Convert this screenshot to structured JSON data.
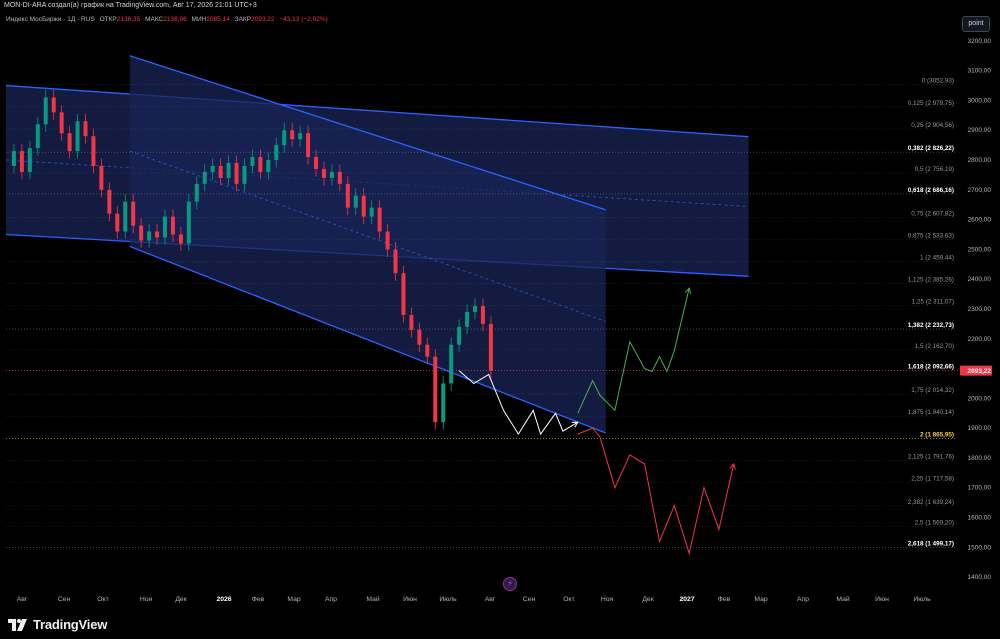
{
  "header": {
    "publish_line": "MON-DI-ARA создал(а) график на TradingView.com, Авг 17, 2026 21:01 UTC+3"
  },
  "legend": {
    "symbol": "Индекс МосБиржи · 1Д · RUS",
    "open_label": "ОТКР",
    "open": "2136,35",
    "high_label": "МАКС",
    "high": "2138,96",
    "low_label": "МИН",
    "low": "2085,14",
    "close_label": "ЗАКР",
    "close": "2093,22",
    "change": "−43,13 (−2,02%)"
  },
  "toolbar": {
    "point_label": "point"
  },
  "branding": {
    "logo_text": "TradingView"
  },
  "colors": {
    "background": "#000000",
    "channel_fill": "#1a2456",
    "channel_line": "#2962ff",
    "candle_up": "#089981",
    "candle_down": "#f23645",
    "projection_up": "#4caf50",
    "projection_down": "#f23645",
    "projection_neutral": "#ffffff",
    "price_tag": "#f23645"
  },
  "chart_data": {
    "type": "candlestick",
    "title": "",
    "x_ticks": [
      "Авг",
      "Сен",
      "Окт",
      "Ноя",
      "Дек",
      "2026",
      "Фев",
      "Мар",
      "Апр",
      "Май",
      "Июн",
      "Июль",
      "Авг",
      "Сен",
      "Окт",
      "Ноя",
      "Дек",
      "2027",
      "Фев",
      "Мар",
      "Апр",
      "Май",
      "Июн",
      "Июль"
    ],
    "y_ticks": [
      1400,
      1500,
      1600,
      1700,
      1800,
      1900,
      2000,
      2100,
      2200,
      2300,
      2400,
      2500,
      2600,
      2700,
      2800,
      2900,
      3000,
      3100,
      3200
    ],
    "y_tick_labels": [
      "1400,00",
      "1500,00",
      "1600,00",
      "1700,00",
      "1800,00",
      "1900,00",
      "2000,00",
      "2100,00",
      "2200,00",
      "2300,00",
      "2400,00",
      "2500,00",
      "2600,00",
      "2700,00",
      "2800,00",
      "2900,00",
      "3000,00",
      "3100,00",
      "3200,00"
    ],
    "ylim": [
      1350,
      3270
    ],
    "last_price": 2093.22,
    "last_price_label": "2093,22",
    "price_path": [
      {
        "x": 0,
        "y": 2780
      },
      {
        "x": 1,
        "y": 2830
      },
      {
        "x": 2,
        "y": 2760
      },
      {
        "x": 3,
        "y": 2840
      },
      {
        "x": 4,
        "y": 2920
      },
      {
        "x": 5,
        "y": 3010
      },
      {
        "x": 6,
        "y": 2960
      },
      {
        "x": 7,
        "y": 2890
      },
      {
        "x": 8,
        "y": 2830
      },
      {
        "x": 9,
        "y": 2930
      },
      {
        "x": 10,
        "y": 2880
      },
      {
        "x": 11,
        "y": 2780
      },
      {
        "x": 12,
        "y": 2700
      },
      {
        "x": 13,
        "y": 2620
      },
      {
        "x": 14,
        "y": 2560
      },
      {
        "x": 15,
        "y": 2660
      },
      {
        "x": 16,
        "y": 2580
      },
      {
        "x": 17,
        "y": 2530
      },
      {
        "x": 18,
        "y": 2560
      },
      {
        "x": 19,
        "y": 2540
      },
      {
        "x": 20,
        "y": 2610
      },
      {
        "x": 21,
        "y": 2550
      },
      {
        "x": 22,
        "y": 2520
      },
      {
        "x": 23,
        "y": 2660
      },
      {
        "x": 24,
        "y": 2720
      },
      {
        "x": 25,
        "y": 2760
      },
      {
        "x": 26,
        "y": 2780
      },
      {
        "x": 27,
        "y": 2740
      },
      {
        "x": 28,
        "y": 2790
      },
      {
        "x": 29,
        "y": 2720
      },
      {
        "x": 30,
        "y": 2780
      },
      {
        "x": 31,
        "y": 2810
      },
      {
        "x": 32,
        "y": 2760
      },
      {
        "x": 33,
        "y": 2800
      },
      {
        "x": 34,
        "y": 2850
      },
      {
        "x": 35,
        "y": 2900
      },
      {
        "x": 36,
        "y": 2870
      },
      {
        "x": 37,
        "y": 2890
      },
      {
        "x": 38,
        "y": 2810
      },
      {
        "x": 39,
        "y": 2770
      },
      {
        "x": 40,
        "y": 2740
      },
      {
        "x": 41,
        "y": 2760
      },
      {
        "x": 42,
        "y": 2720
      },
      {
        "x": 43,
        "y": 2640
      },
      {
        "x": 44,
        "y": 2680
      },
      {
        "x": 45,
        "y": 2610
      },
      {
        "x": 46,
        "y": 2640
      },
      {
        "x": 47,
        "y": 2560
      },
      {
        "x": 48,
        "y": 2500
      },
      {
        "x": 49,
        "y": 2420
      },
      {
        "x": 50,
        "y": 2280
      },
      {
        "x": 51,
        "y": 2230
      },
      {
        "x": 52,
        "y": 2180
      },
      {
        "x": 53,
        "y": 2140
      },
      {
        "x": 54,
        "y": 1920
      },
      {
        "x": 55,
        "y": 2050
      },
      {
        "x": 56,
        "y": 2180
      },
      {
        "x": 57,
        "y": 2240
      },
      {
        "x": 58,
        "y": 2290
      },
      {
        "x": 59,
        "y": 2310
      },
      {
        "x": 60,
        "y": 2250
      },
      {
        "x": 61,
        "y": 2093
      }
    ],
    "channels": [
      {
        "name": "",
        "type": "wide-descending",
        "upper": [
          {
            "x": 0,
            "y": 3050
          },
          {
            "x": 100,
            "y": 2830
          }
        ],
        "lower": [
          {
            "x": 0,
            "y": 2550
          },
          {
            "x": 100,
            "y": 2370
          }
        ]
      },
      {
        "name": "",
        "type": "steep-descending",
        "upper": [
          {
            "x": 13,
            "y": 3150
          },
          {
            "x": 100,
            "y": 2250
          }
        ],
        "lower": [
          {
            "x": 13,
            "y": 2510
          },
          {
            "x": 100,
            "y": 1420
          }
        ]
      }
    ],
    "fibonacci_levels": [
      {
        "ratio": "0",
        "value": 3052.93,
        "label": "0 (3052,93)"
      },
      {
        "ratio": "0,125",
        "value": 2978.75,
        "label": "0,125 (2 978,75)"
      },
      {
        "ratio": "0,25",
        "value": 2904.56,
        "label": "0,25 (2 904,56)"
      },
      {
        "ratio": "0,382",
        "value": 2826.22,
        "label": "0,382 (2 826,22)",
        "highlight": true
      },
      {
        "ratio": "0,5",
        "value": 2756.19,
        "label": "0,5 (2 756,19)"
      },
      {
        "ratio": "0,618",
        "value": 2686.16,
        "label": "0,618 (2 686,16)",
        "highlight": true
      },
      {
        "ratio": "0,75",
        "value": 2607.82,
        "label": "0,75 (2 607,82)"
      },
      {
        "ratio": "0,875",
        "value": 2533.63,
        "label": "0,875 (2 533,63)"
      },
      {
        "ratio": "1",
        "value": 2459.44,
        "label": "1 (2 459,44)"
      },
      {
        "ratio": "1,125",
        "value": 2385.26,
        "label": "1,125 (2 385,26)"
      },
      {
        "ratio": "1,25",
        "value": 2311.07,
        "label": "1,25 (2 311,07)"
      },
      {
        "ratio": "1,382",
        "value": 2232.73,
        "label": "1,382 (2 232,73)",
        "highlight": true
      },
      {
        "ratio": "1,5",
        "value": 2162.7,
        "label": "1,5 (2 162,70)"
      },
      {
        "ratio": "1,618",
        "value": 2092.66,
        "label": "1,618 (2 092,66)",
        "highlight": true
      },
      {
        "ratio": "1,75",
        "value": 2014.32,
        "label": "1,75 (2 014,32)"
      },
      {
        "ratio": "1,875",
        "value": 1940.14,
        "label": "1,875 (1 940,14)"
      },
      {
        "ratio": "2",
        "value": 1865.95,
        "label": "2 (1 865,95)",
        "highlight": true,
        "color": "#f5d142"
      },
      {
        "ratio": "2,125",
        "value": 1791.76,
        "label": "2,125 (1 791,76)"
      },
      {
        "ratio": "2,25",
        "value": 1717.58,
        "label": "2,25 (1 717,58)"
      },
      {
        "ratio": "2,382",
        "value": 1639.24,
        "label": "2,382 (1 639,24)"
      },
      {
        "ratio": "2,5",
        "value": 1569.2,
        "label": "2,5 (1 569,20)"
      },
      {
        "ratio": "2,618",
        "value": 1499.17,
        "label": "2,618 (1 499,17)",
        "highlight": true
      }
    ],
    "projections": {
      "neutral": [
        {
          "x": 61,
          "y": 2093
        },
        {
          "x": 63,
          "y": 2050
        },
        {
          "x": 65,
          "y": 2080
        },
        {
          "x": 67,
          "y": 1960
        },
        {
          "x": 69,
          "y": 1880
        },
        {
          "x": 71,
          "y": 1960
        },
        {
          "x": 72,
          "y": 1880
        },
        {
          "x": 74,
          "y": 1950
        },
        {
          "x": 75,
          "y": 1890
        },
        {
          "x": 77,
          "y": 1920
        }
      ],
      "bullish": [
        {
          "x": 77,
          "y": 1950
        },
        {
          "x": 79,
          "y": 2060
        },
        {
          "x": 80,
          "y": 2010
        },
        {
          "x": 82,
          "y": 1960
        },
        {
          "x": 84,
          "y": 2190
        },
        {
          "x": 86,
          "y": 2100
        },
        {
          "x": 87,
          "y": 2090
        },
        {
          "x": 88,
          "y": 2140
        },
        {
          "x": 89,
          "y": 2090
        },
        {
          "x": 90,
          "y": 2160
        },
        {
          "x": 92,
          "y": 2370
        }
      ],
      "bearish": [
        {
          "x": 77,
          "y": 1880
        },
        {
          "x": 79,
          "y": 1900
        },
        {
          "x": 80,
          "y": 1870
        },
        {
          "x": 82,
          "y": 1700
        },
        {
          "x": 84,
          "y": 1810
        },
        {
          "x": 86,
          "y": 1780
        },
        {
          "x": 88,
          "y": 1520
        },
        {
          "x": 90,
          "y": 1640
        },
        {
          "x": 92,
          "y": 1480
        },
        {
          "x": 94,
          "y": 1700
        },
        {
          "x": 96,
          "y": 1560
        },
        {
          "x": 98,
          "y": 1780
        }
      ]
    }
  }
}
